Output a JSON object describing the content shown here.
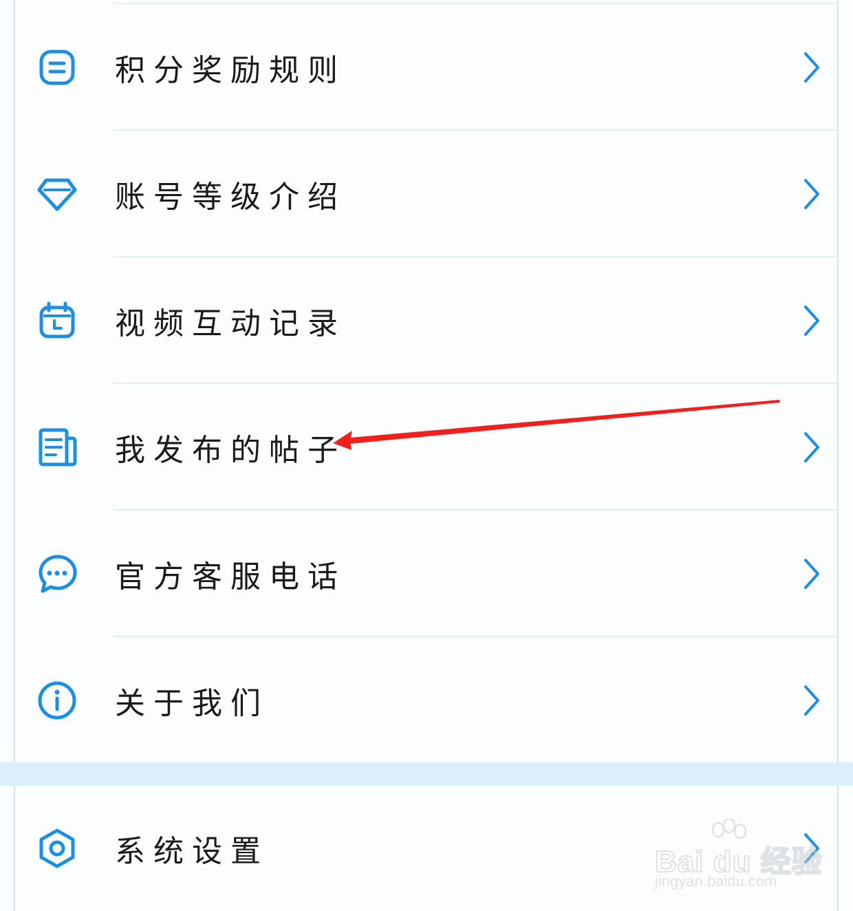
{
  "menu": {
    "items": [
      {
        "label": "积分奖励规则",
        "icon": "document-lines-icon"
      },
      {
        "label": "账号等级介绍",
        "icon": "diamond-icon"
      },
      {
        "label": "视频互动记录",
        "icon": "calendar-clock-icon"
      },
      {
        "label": "我发布的帖子",
        "icon": "posts-list-icon"
      },
      {
        "label": "官方客服电话",
        "icon": "chat-bubble-icon"
      },
      {
        "label": "关于我们",
        "icon": "info-icon"
      }
    ],
    "settings": {
      "label": "系统设置",
      "icon": "hexagon-settings-icon"
    }
  },
  "colors": {
    "accent": "#1e8fe0",
    "annotation_arrow": "#f0201c",
    "section_gap": "#dbeefb"
  },
  "watermark": {
    "brand": "Bai du 经验",
    "url": "jingyan.baidu.com"
  }
}
